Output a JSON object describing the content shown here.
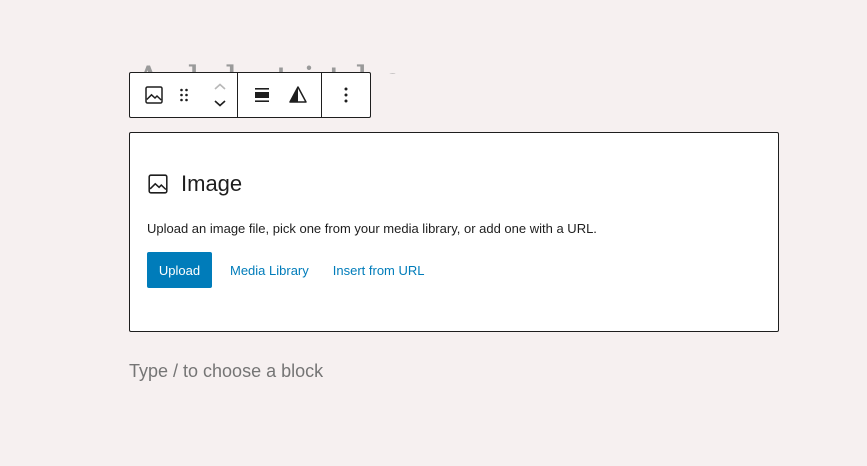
{
  "post_title_partial": "Add title",
  "toolbar": {
    "block_icon": "image-icon",
    "drag_icon": "drag-handle-icon",
    "move_up_icon": "chevron-up-icon",
    "move_down_icon": "chevron-down-icon",
    "align_icon": "align-wide-icon",
    "duotone_icon": "duotone-filter-icon",
    "options_icon": "more-vertical-icon"
  },
  "image_block": {
    "icon": "image-icon",
    "label": "Image",
    "instructions": "Upload an image file, pick one from your media library, or add one with a URL.",
    "upload_label": "Upload",
    "media_library_label": "Media Library",
    "insert_url_label": "Insert from URL"
  },
  "appender": {
    "placeholder": "Type / to choose a block"
  },
  "colors": {
    "background": "#f6f0f0",
    "accent": "#007cba",
    "border": "#1e1e1e",
    "placeholder_text": "#757575"
  }
}
